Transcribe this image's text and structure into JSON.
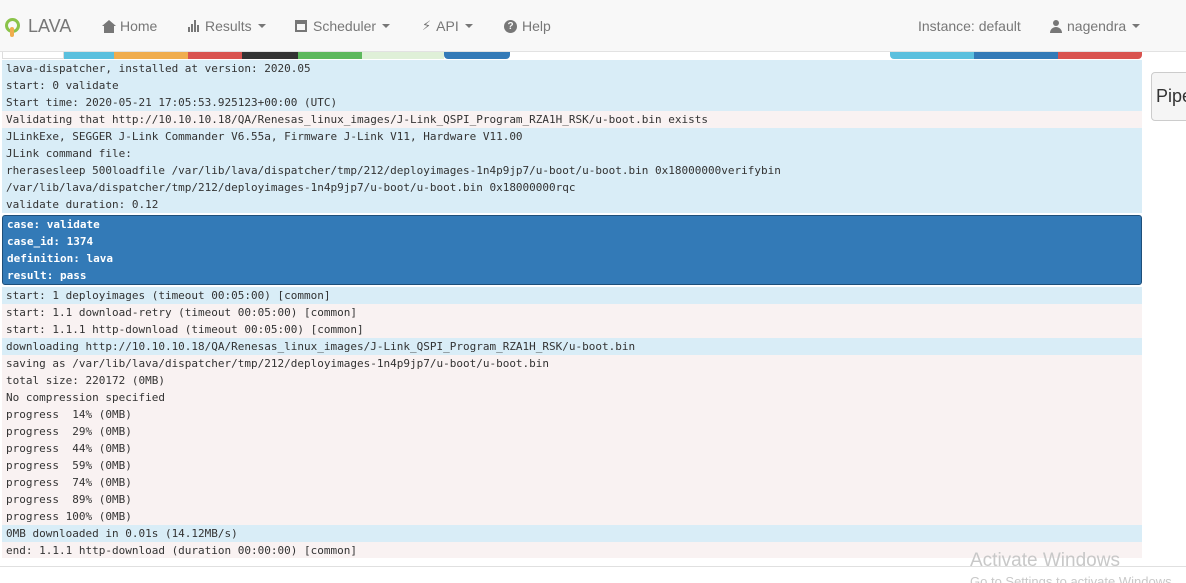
{
  "nav": {
    "brand": "LAVA",
    "home": "Home",
    "results": "Results",
    "scheduler": "Scheduler",
    "api": "API",
    "help": "Help",
    "instance": "Instance: default",
    "user": "nagendra"
  },
  "strips": {
    "colors": [
      "#5bc0de",
      "#f0ad4e",
      "#d9534f",
      "#333333",
      "#5cb85c",
      "#dff0d8",
      "#337ab7"
    ]
  },
  "pipeline_button": "Pipe",
  "log": {
    "group1": [
      "lava-dispatcher, installed at version: 2020.05",
      "start: 0 validate",
      "Start time: 2020-05-21 17:05:53.925123+00:00 (UTC)"
    ],
    "validating": "Validating that http://10.10.10.18/QA/Renesas_linux_images/J-Link_QSPI_Program_RZA1H_RSK/u-boot.bin exists",
    "group2": [
      "JLinkExe, SEGGER J-Link Commander V6.55a, Firmware J-Link V11, Hardware V11.00",
      "JLink command file:",
      "rherasesleep 500loadfile /var/lib/lava/dispatcher/tmp/212/deployimages-1n4p9jp7/u-boot/u-boot.bin 0x18000000verifybin",
      "/var/lib/lava/dispatcher/tmp/212/deployimages-1n4p9jp7/u-boot/u-boot.bin 0x18000000rqc",
      "validate duration: 0.12"
    ],
    "result_block": [
      "case: validate",
      "case_id: 1374",
      "definition: lava",
      "result: pass"
    ],
    "start_deploy": "start: 1 deployimages (timeout 00:05:00) [common]",
    "group3": [
      "start: 1.1 download-retry (timeout 00:05:00) [common]",
      "start: 1.1.1 http-download (timeout 00:05:00) [common]"
    ],
    "downloading": "downloading http://10.10.10.18/QA/Renesas_linux_images/J-Link_QSPI_Program_RZA1H_RSK/u-boot.bin",
    "group4": [
      "saving as /var/lib/lava/dispatcher/tmp/212/deployimages-1n4p9jp7/u-boot/u-boot.bin",
      "total size: 220172 (0MB)",
      "No compression specified",
      "progress  14% (0MB)",
      "progress  29% (0MB)",
      "progress  44% (0MB)",
      "progress  59% (0MB)",
      "progress  74% (0MB)",
      "progress  89% (0MB)",
      "progress 100% (0MB)"
    ],
    "downloaded": "0MB downloaded in 0.01s (14.12MB/s)",
    "end_line": "end: 1.1.1 http-download (duration 00:00:00) [common]"
  },
  "watermark": {
    "line1": "Activate Windows",
    "line2": "Go to Settings to activate Windows."
  }
}
